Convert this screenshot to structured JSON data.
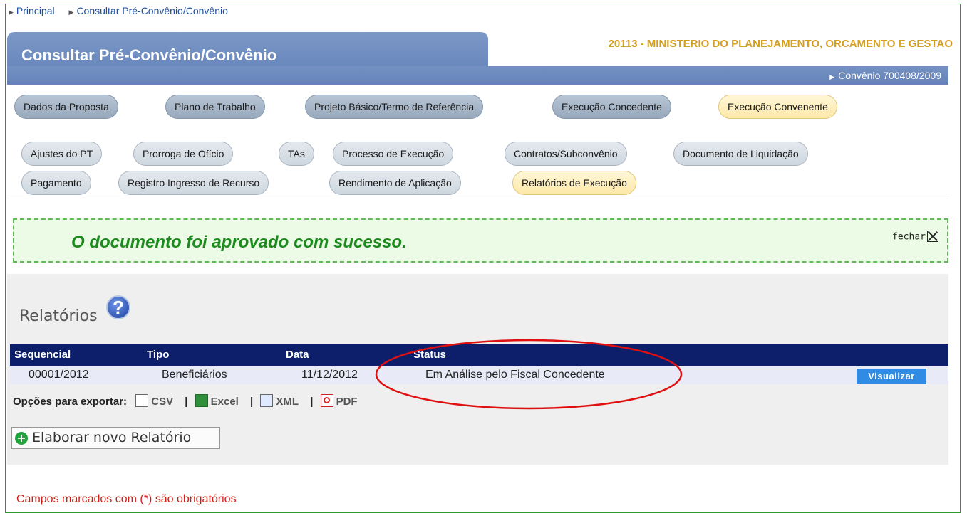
{
  "breadcrumb": {
    "items": [
      "Principal",
      "Consultar Pré-Convênio/Convênio"
    ]
  },
  "header": {
    "title": "Consultar Pré-Convênio/Convênio",
    "organization": "20113 - MINISTERIO DO PLANEJAMENTO, ORCAMENTO E GESTAO",
    "convenio": "Convênio 700408/2009"
  },
  "tabs_main": [
    {
      "label": "Dados da Proposta"
    },
    {
      "label": "Plano de Trabalho"
    },
    {
      "label": "Projeto Básico/Termo de Referência"
    },
    {
      "label": "Execução Concedente"
    },
    {
      "label": "Execução Convenente"
    }
  ],
  "tabs_sub_row1": [
    {
      "label": "Ajustes do PT"
    },
    {
      "label": "Prorroga de Ofício"
    },
    {
      "label": "TAs"
    },
    {
      "label": "Processo de Execução"
    },
    {
      "label": "Contratos/Subconvênio"
    },
    {
      "label": "Documento de Liquidação"
    }
  ],
  "tabs_sub_row2": [
    {
      "label": "Pagamento"
    },
    {
      "label": "Registro Ingresso de Recurso"
    },
    {
      "label": "Rendimento de Aplicação"
    },
    {
      "label": "Relatórios de Execução"
    }
  ],
  "alert": {
    "message": "O documento foi aprovado com sucesso.",
    "close_label": "fechar"
  },
  "reports": {
    "title": "Relatórios",
    "help_icon": "?",
    "columns": [
      "Sequencial",
      "Tipo",
      "Data",
      "Status"
    ],
    "rows": [
      {
        "sequencial": "00001/2012",
        "tipo": "Beneficiários",
        "data": "11/12/2012",
        "status": "Em Análise pelo Fiscal Concedente",
        "action": "Visualizar"
      }
    ],
    "export": {
      "label": "Opções para exportar:",
      "csv": "CSV",
      "excel": "Excel",
      "xml": "XML",
      "pdf": "PDF",
      "separator": "|"
    },
    "new_button": "Elaborar novo Relatório",
    "plus": "+"
  },
  "footer": {
    "required_note": "Campos marcados com (*) são obrigatórios"
  },
  "colors": {
    "accent": "#6786bb",
    "table_header": "#0d1f6b",
    "success": "#1c8a1c",
    "required": "#d21c1c",
    "annotation": "#e01010"
  }
}
